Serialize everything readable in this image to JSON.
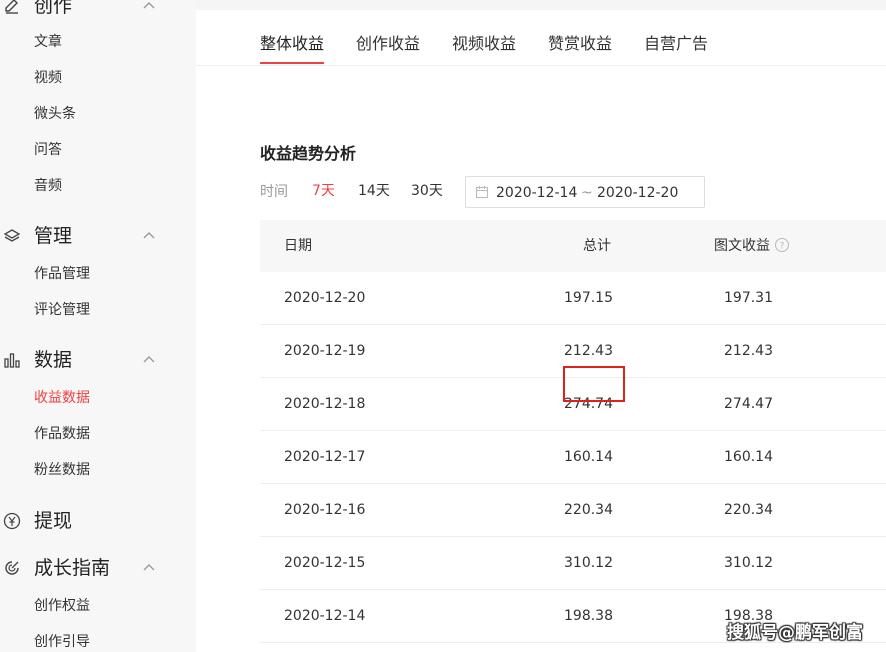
{
  "sidebar": {
    "sections": [
      {
        "label": "创作",
        "icon": "pencil-icon",
        "items": [
          "文章",
          "视频",
          "微头条",
          "问答",
          "音频"
        ]
      },
      {
        "label": "管理",
        "icon": "layers-icon",
        "items": [
          "作品管理",
          "评论管理"
        ]
      },
      {
        "label": "数据",
        "icon": "bar-chart-icon",
        "items": [
          "收益数据",
          "作品数据",
          "粉丝数据"
        ],
        "active_item": "收益数据"
      },
      {
        "label": "提现",
        "icon": "yuan-coin-icon",
        "items": []
      },
      {
        "label": "成长指南",
        "icon": "growth-icon",
        "items": [
          "创作权益",
          "创作引导"
        ]
      }
    ]
  },
  "tabs": [
    "整体收益",
    "创作收益",
    "视频收益",
    "赞赏收益",
    "自营广告"
  ],
  "active_tab": "整体收益",
  "trend": {
    "title": "收益趋势分析",
    "time_label": "时间",
    "ranges": [
      "7天",
      "14天",
      "30天"
    ],
    "active_range": "7天",
    "date_start": "2020-12-14",
    "date_sep": "~",
    "date_end": "2020-12-20"
  },
  "table": {
    "headers": [
      "日期",
      "总计",
      "图文收益"
    ],
    "rows": [
      [
        "2020-12-20",
        "197.15",
        "197.31"
      ],
      [
        "2020-12-19",
        "212.43",
        "212.43"
      ],
      [
        "2020-12-18",
        "274.74",
        "274.47"
      ],
      [
        "2020-12-17",
        "160.14",
        "160.14"
      ],
      [
        "2020-12-16",
        "220.34",
        "220.34"
      ],
      [
        "2020-12-15",
        "310.12",
        "310.12"
      ],
      [
        "2020-12-14",
        "198.38",
        "198.38"
      ]
    ]
  },
  "colors": {
    "accent": "#f04142",
    "highlight_box": "#e0201f"
  },
  "watermark": "搜狐号@鹏军创富"
}
